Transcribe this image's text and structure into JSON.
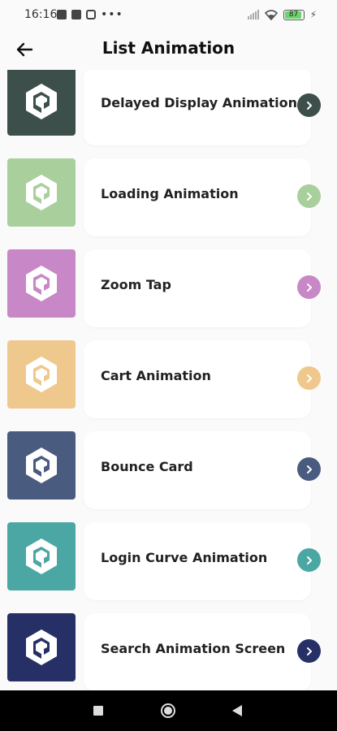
{
  "status_bar": {
    "time": "16:16",
    "battery_level": "87",
    "more_indicator": "•••",
    "icons": [
      "message-icon",
      "news-icon",
      "instagram-icon",
      "signal-icon",
      "wifi-icon",
      "battery-icon",
      "charging-icon"
    ]
  },
  "app_bar": {
    "title": "List Animation",
    "back_icon": "arrow-left-icon"
  },
  "list": {
    "items": [
      {
        "label": "Delayed Display Animation",
        "color": "#3d4f4a"
      },
      {
        "label": "Loading Animation",
        "color": "#a8cf9c"
      },
      {
        "label": "Zoom Tap",
        "color": "#c887c6"
      },
      {
        "label": "Cart Animation",
        "color": "#efc88d"
      },
      {
        "label": "Bounce Card",
        "color": "#4a5b80"
      },
      {
        "label": "Login Curve Animation",
        "color": "#4ba7a3"
      },
      {
        "label": "Search Animation Screen",
        "color": "#263067"
      }
    ],
    "thumb_icon": "hexagon-logo-icon",
    "action_icon": "chevron-right-icon"
  },
  "nav_bar": {
    "icons": [
      "recents-square-icon",
      "home-circle-icon",
      "back-triangle-icon"
    ]
  }
}
